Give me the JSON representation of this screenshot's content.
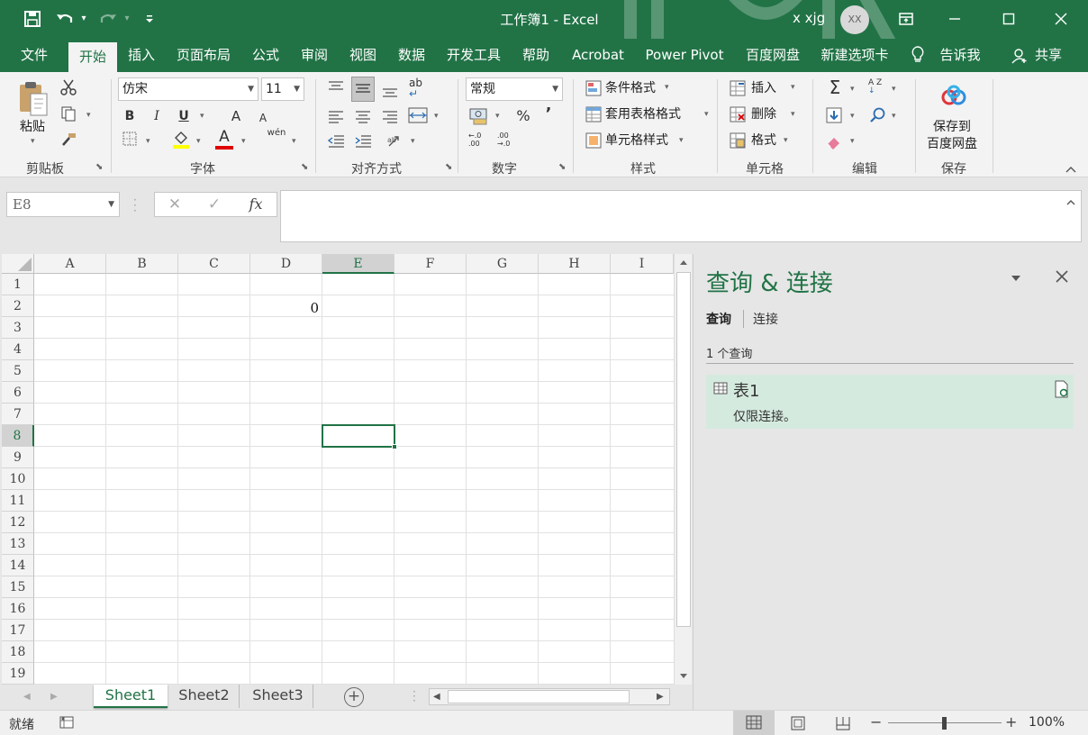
{
  "titlebar": {
    "title": "工作簿1 - Excel",
    "user": "x xjg",
    "avatar_initials": "XX",
    "qa_caret": "▾",
    "accent": "#217346"
  },
  "menu": {
    "tabs": [
      {
        "label": "文件"
      },
      {
        "label": "开始",
        "active": true
      },
      {
        "label": "插入"
      },
      {
        "label": "页面布局"
      },
      {
        "label": "公式"
      },
      {
        "label": "审阅"
      },
      {
        "label": "视图"
      },
      {
        "label": "数据"
      },
      {
        "label": "开发工具"
      },
      {
        "label": "帮助"
      },
      {
        "label": "Acrobat"
      },
      {
        "label": "Power Pivot"
      },
      {
        "label": "百度网盘"
      },
      {
        "label": "新建选项卡"
      }
    ],
    "tell_me": "告诉我",
    "share": "共享"
  },
  "ribbon": {
    "clipboard": {
      "paste": "粘贴",
      "group": "剪贴板"
    },
    "font": {
      "name": "仿宋",
      "size": "11",
      "bold": "B",
      "italic": "I",
      "underline": "U",
      "grow": "A",
      "shrink": "A",
      "color_a": "A",
      "phonetic": "wén",
      "group": "字体"
    },
    "alignment": {
      "group": "对齐方式",
      "wrap": "ab"
    },
    "number": {
      "format": "常规",
      "percent": "%",
      "comma": "’",
      "inc": "←.0\n.00",
      "dec": ".00\n→.0",
      "group": "数字"
    },
    "styles": {
      "conditional": "条件格式",
      "table": "套用表格格式",
      "cell": "单元格样式",
      "group": "样式"
    },
    "cells": {
      "insert": "插入",
      "delete": "删除",
      "format": "格式",
      "group": "单元格"
    },
    "editing": {
      "sigma": "Σ",
      "sort": "A Z",
      "group": "编辑"
    },
    "save": {
      "line1": "保存到",
      "line2": "百度网盘",
      "group": "保存"
    }
  },
  "formula_bar": {
    "name_box": "E8",
    "cancel": "✕",
    "enter": "✓",
    "fx": "fx",
    "formula": ""
  },
  "sheet": {
    "columns": [
      "A",
      "B",
      "C",
      "D",
      "E",
      "F",
      "G",
      "H",
      "I"
    ],
    "rows": [
      "1",
      "2",
      "3",
      "4",
      "5",
      "6",
      "7",
      "8",
      "9",
      "10",
      "11",
      "12",
      "13",
      "14",
      "15",
      "16",
      "17",
      "18",
      "19"
    ],
    "cell_D2": "0",
    "active_cell": "E8"
  },
  "sheet_tabs": {
    "tabs": [
      {
        "label": "Sheet1",
        "active": true
      },
      {
        "label": "Sheet2"
      },
      {
        "label": "Sheet3"
      }
    ],
    "add": "+"
  },
  "status": {
    "ready": "就绪",
    "zoom": "100%",
    "minus": "−",
    "plus": "+"
  },
  "panel": {
    "title": "查询 & 连接",
    "tab_queries": "查询",
    "tab_connections": "连接",
    "count": "1 个查询",
    "query_name": "表1",
    "query_status": "仅限连接。",
    "highlight": "#d5eadf"
  }
}
